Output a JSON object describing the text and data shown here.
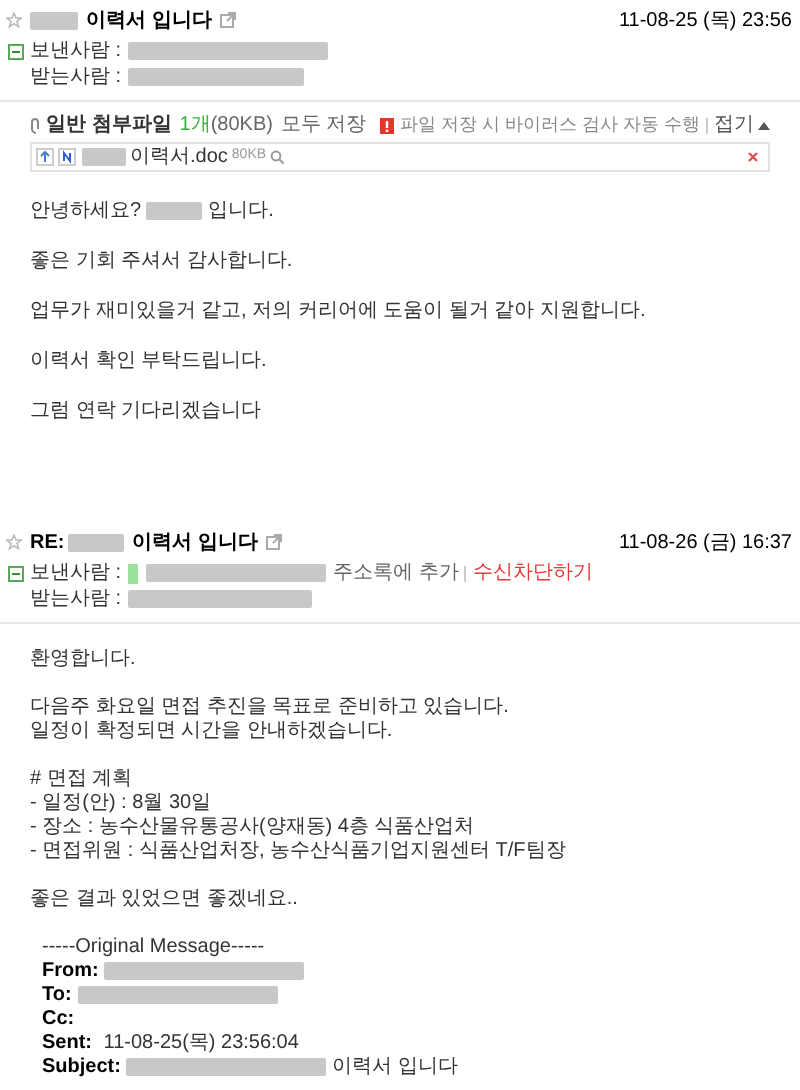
{
  "messages": [
    {
      "subject": "이력서 입니다",
      "starred": false,
      "date": "11-08-25 (목) 23:56",
      "sender_label": "보낸사람 :",
      "recipient_label": "받는사람 :",
      "attachments": {
        "title": "일반 첨부파일",
        "count": "1개",
        "size": "(80KB)",
        "save_all": "모두 저장",
        "virus_notice": "파일 저장 시 바이러스 검사 자동 수행",
        "collapse": "접기",
        "files": [
          {
            "name": "이력서.doc",
            "size": "80KB"
          }
        ]
      },
      "paragraphs": [
        [
          [
            {
              "kind": "text",
              "text": "안녕하세요? "
            },
            {
              "kind": "blur"
            },
            {
              "kind": "text",
              "text": " 입니다."
            }
          ]
        ],
        [
          [
            {
              "kind": "text",
              "text": "좋은 기회 주셔서 감사합니다."
            }
          ]
        ],
        [
          [
            {
              "kind": "text",
              "text": "업무가 재미있을거 같고, 저의 커리어에 도움이 될거 같아 지원합니다."
            }
          ]
        ],
        [
          [
            {
              "kind": "text",
              "text": "이력서 확인 부탁드립니다."
            }
          ]
        ],
        [
          [
            {
              "kind": "text",
              "text": "그럼 연락 기다리겠습니다"
            }
          ]
        ]
      ]
    },
    {
      "subject_prefix": "RE:",
      "subject": "이력서 입니다",
      "starred": false,
      "date": "11-08-26 (금) 16:37",
      "sender_label": "보낸사람 :",
      "recipient_label": "받는사람 :",
      "sender_actions": [
        {
          "text": "주소록에 추가",
          "kind": "link"
        },
        {
          "text": "수신차단하기",
          "kind": "warning"
        }
      ],
      "paragraphs": [
        [
          [
            {
              "kind": "text",
              "text": "환영합니다."
            }
          ]
        ],
        [
          [
            {
              "kind": "text",
              "text": "다음주 화요일 면접 추진을 목표로 준비하고 있습니다."
            }
          ],
          [
            {
              "kind": "text",
              "text": "일정이 확정되면 시간을 안내하겠습니다."
            }
          ]
        ],
        [
          [
            {
              "kind": "text",
              "text": "# 면접 계획"
            }
          ],
          [
            {
              "kind": "text",
              "text": "- 일정(안) : 8월 30일"
            }
          ],
          [
            {
              "kind": "text",
              "text": "- 장소 : 농수산물유통공사(양재동) 4층 식품산업처"
            }
          ],
          [
            {
              "kind": "text",
              "text": "- 면접위원 : 식품산업처장, 농수산식품기업지원센터 T/F팀장"
            }
          ]
        ],
        [
          [
            {
              "kind": "text",
              "text": "좋은 결과 있었으면 좋겠네요.."
            }
          ]
        ],
        [
          [
            {
              "kind": "quote",
              "text": "-----Original Message-----"
            }
          ],
          [
            {
              "kind": "field",
              "label": "From:"
            },
            {
              "kind": "blur"
            }
          ],
          [
            {
              "kind": "field",
              "label": "To:"
            },
            {
              "kind": "blur"
            }
          ],
          [
            {
              "kind": "field",
              "label": "Cc:"
            }
          ],
          [
            {
              "kind": "field",
              "label": "Sent:"
            },
            {
              "kind": "quote",
              "text": " 11-08-25(목) 23:56:04"
            }
          ],
          [
            {
              "kind": "field",
              "label": "Subject:"
            },
            {
              "kind": "blur"
            },
            {
              "kind": "quote",
              "text": " 이력서 입니다"
            }
          ]
        ]
      ]
    }
  ]
}
